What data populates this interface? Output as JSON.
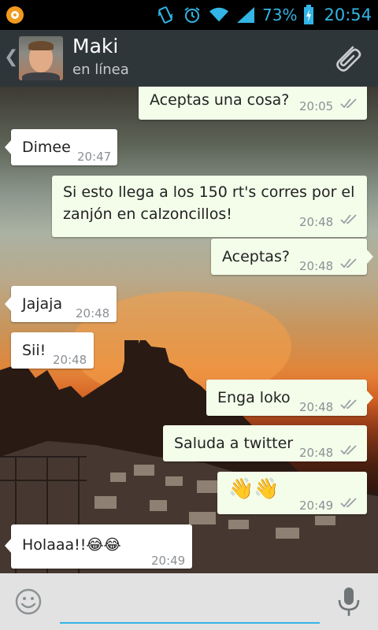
{
  "status_bar": {
    "battery_percent": "73%",
    "clock": "20:54",
    "icons": [
      "app-notification-icon",
      "vibrate-icon",
      "alarm-icon",
      "wifi-icon",
      "signal-icon",
      "battery-icon"
    ],
    "accent": "#33b5e5"
  },
  "header": {
    "contact_name": "Maki",
    "contact_status": "en línea",
    "icons": [
      "back-icon",
      "avatar",
      "attach-icon"
    ],
    "background": "#2f363a"
  },
  "messages": [
    {
      "direction": "out",
      "text": "Aceptas una cosa?",
      "time": "20:05",
      "status": "read-ticks"
    },
    {
      "direction": "in",
      "text": "Dimee",
      "time": "20:47"
    },
    {
      "direction": "out",
      "text_line1": "Si esto llega a los 150 rt's corres por el",
      "text_line2": "zanjón en calzoncillos!",
      "time": "20:48",
      "status": "read-ticks"
    },
    {
      "direction": "out",
      "text": "Aceptas?",
      "time": "20:48",
      "status": "read-ticks"
    },
    {
      "direction": "in",
      "text": "Jajaja",
      "time": "20:48"
    },
    {
      "direction": "in",
      "text": "Sii!",
      "time": "20:48"
    },
    {
      "direction": "out",
      "text": "Enga loko",
      "time": "20:48",
      "status": "read-ticks"
    },
    {
      "direction": "out",
      "text": "Saluda a twitter",
      "time": "20:48",
      "status": "read-ticks"
    },
    {
      "direction": "out",
      "text": "👋👋",
      "time": "20:49",
      "status": "read-ticks"
    },
    {
      "direction": "in",
      "text": "Holaaa!!😂😂",
      "time": "20:49"
    }
  ],
  "input_bar": {
    "value": "",
    "icons": [
      "emoji-icon",
      "microphone-icon"
    ]
  },
  "colors": {
    "incoming_bubble": "#ffffff",
    "outgoing_bubble": "#f3fdea",
    "tick": "#9aa0a4"
  }
}
